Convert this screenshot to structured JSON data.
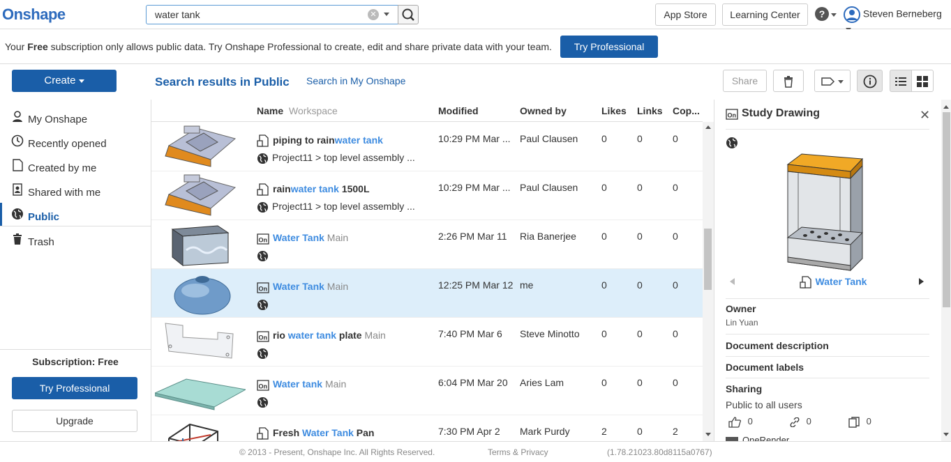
{
  "app": {
    "logo": "Onshape"
  },
  "search": {
    "value": "water tank"
  },
  "header": {
    "app_store": "App Store",
    "learning_center": "Learning Center",
    "user_name": "Steven Berneberg"
  },
  "notice": {
    "pre": "Your ",
    "bold": "Free",
    "post": " subscription only allows public data. Try Onshape Professional to create, edit and share private data with your team.",
    "button": "Try Professional"
  },
  "toolbar": {
    "create": "Create",
    "results_title": "Search results in Public",
    "search_my": "Search in My Onshape",
    "share": "Share"
  },
  "sidebar": {
    "items": [
      {
        "label": "My Onshape",
        "icon": "person-icon"
      },
      {
        "label": "Recently opened",
        "icon": "clock-icon"
      },
      {
        "label": "Created by me",
        "icon": "document-icon"
      },
      {
        "label": "Shared with me",
        "icon": "shared-icon"
      },
      {
        "label": "Public",
        "icon": "globe-icon"
      },
      {
        "label": "Trash",
        "icon": "trash-icon"
      }
    ],
    "subscription": "Subscription: Free",
    "try_pro": "Try Professional",
    "upgrade": "Upgrade"
  },
  "table": {
    "headers": {
      "name": "Name",
      "workspace": "Workspace",
      "modified": "Modified",
      "owned": "Owned by",
      "likes": "Likes",
      "links": "Links",
      "copies": "Cop..."
    },
    "rows": [
      {
        "pre": "piping to rain",
        "hl": "water tank",
        "post": "",
        "ws": "",
        "sub": "Project11 > top level assembly  ...",
        "modified": "10:29 PM Mar ...",
        "owner": "Paul Clausen",
        "likes": "0",
        "links": "0",
        "copies": "0"
      },
      {
        "pre": "rain",
        "hl": "water tank",
        "post": " 1500L",
        "ws": "",
        "sub": "Project11 > top level assembly  ...",
        "modified": "10:29 PM Mar ...",
        "owner": "Paul Clausen",
        "likes": "0",
        "links": "0",
        "copies": "0"
      },
      {
        "pre": "",
        "hl": "Water Tank",
        "post": "",
        "ws": " Main",
        "sub": "",
        "modified": "2:26 PM Mar 11",
        "owner": "Ria Banerjee",
        "likes": "0",
        "links": "0",
        "copies": "0"
      },
      {
        "pre": "",
        "hl": "Water Tank",
        "post": "",
        "ws": " Main",
        "sub": "",
        "modified": "12:25 PM Mar 12",
        "owner": "me",
        "likes": "0",
        "links": "0",
        "copies": "0"
      },
      {
        "pre": "rio ",
        "hl": "water tank",
        "post": " plate",
        "ws": " Main",
        "sub": "",
        "modified": "7:40 PM Mar 6",
        "owner": "Steve Minotto",
        "likes": "0",
        "links": "0",
        "copies": "0"
      },
      {
        "pre": "",
        "hl": "Water tank",
        "post": "",
        "ws": " Main",
        "sub": "",
        "modified": "6:04 PM Mar 20",
        "owner": "Aries Lam",
        "likes": "0",
        "links": "0",
        "copies": "0"
      },
      {
        "pre": "Fresh ",
        "hl": "Water Tank",
        "post": " Pan",
        "ws": "",
        "sub": "",
        "modified": "7:30 PM Apr 2",
        "owner": "Mark Purdy",
        "likes": "2",
        "links": "0",
        "copies": "2"
      }
    ]
  },
  "detail": {
    "title": "Study Drawing",
    "doc_name": "Water Tank",
    "owner_label": "Owner",
    "owner": "Lin Yuan",
    "desc_label": "Document description",
    "labels_label": "Document labels",
    "sharing_label": "Sharing",
    "sharing": "Public to all users",
    "likes": "0",
    "links": "0",
    "copies": "0",
    "partial": "OneRender"
  },
  "footer": {
    "copyright": "© 2013 - Present, Onshape Inc. All Rights Reserved.",
    "terms": "Terms & Privacy",
    "version": "(1.78.21023.80d8115a0767)"
  }
}
